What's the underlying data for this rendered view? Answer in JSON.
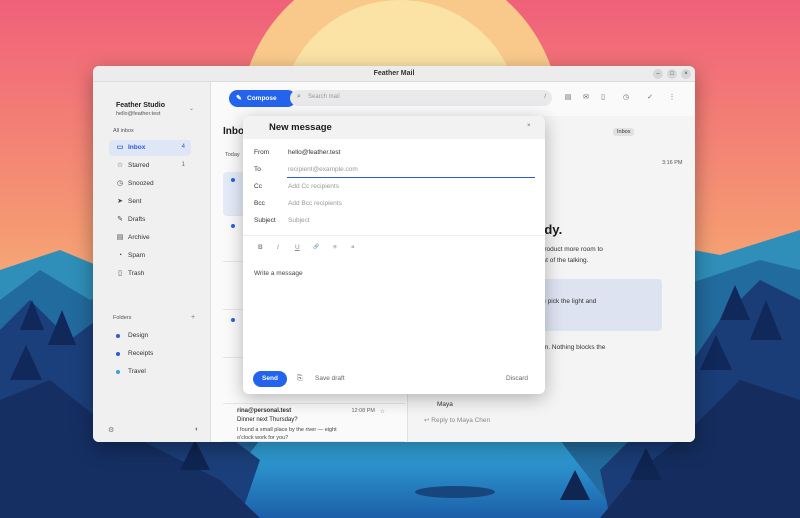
{
  "window": {
    "title": "Feather Mail",
    "controls": {
      "minimize": "–",
      "maximize": "□",
      "close": "×"
    }
  },
  "sidebar": {
    "account_name": "Feather Studio",
    "account_email": "hello@feather.test",
    "section_label": "All inbox",
    "items": [
      {
        "label": "Inbox",
        "count": "4",
        "icon": "inbox-icon",
        "glyph": "▭"
      },
      {
        "label": "Starred",
        "count": "1",
        "icon": "star-icon",
        "glyph": "☆"
      },
      {
        "label": "Snoozed",
        "count": "",
        "icon": "clock-icon",
        "glyph": "◷"
      },
      {
        "label": "Sent",
        "count": "",
        "icon": "send-icon",
        "glyph": "➤"
      },
      {
        "label": "Drafts",
        "count": "",
        "icon": "draft-icon",
        "glyph": "✎"
      },
      {
        "label": "Archive",
        "count": "",
        "icon": "archive-icon",
        "glyph": "▤"
      },
      {
        "label": "Spam",
        "count": "",
        "icon": "spam-icon",
        "glyph": "◔"
      },
      {
        "label": "Trash",
        "count": "",
        "icon": "trash-icon",
        "glyph": "▯"
      }
    ],
    "folders_label": "Folders",
    "folders": [
      {
        "label": "Design",
        "color": "#2a5bd8"
      },
      {
        "label": "Receipts",
        "color": "#2a5bd8"
      },
      {
        "label": "Travel",
        "color": "#3aa0d8"
      }
    ]
  },
  "toolbar": {
    "compose_label": "Compose",
    "search_placeholder": "Search mail",
    "search_shortcut": "/"
  },
  "list": {
    "title": "Inbox",
    "group_label": "Today",
    "messages": [
      {
        "from": "rina@personal.test",
        "time": "12:08 PM",
        "subject": "Dinner next Thursday?",
        "preview": "I found a small place by the river — eight o'clock work for you?"
      }
    ]
  },
  "reader": {
    "tag": "Inbox",
    "time": "3:16 PM",
    "heading_fragment": "s ready.",
    "body_line1": "gave the product more room to",
    "body_line2": "f to do most of the talking.",
    "callout_text": "oon as you pick the light and",
    "body_line3": "final section. Nothing blocks the",
    "signature": "Maya",
    "reply_label": "Reply to Maya Chen"
  },
  "compose": {
    "title": "New message",
    "close_glyph": "×",
    "from_label": "From",
    "from_value": "hello@feather.test",
    "to_label": "To",
    "to_placeholder": "recipient@example.com",
    "cc_label": "Cc",
    "cc_placeholder": "Add Cc recipients",
    "bcc_label": "Bcc",
    "bcc_placeholder": "Add Bcc recipients",
    "subject_label": "Subject",
    "subject_placeholder": "Subject",
    "format": {
      "bold": "B",
      "italic": "I",
      "underline": "U",
      "link": "🔗",
      "list": "≡",
      "quote": "❝"
    },
    "body_placeholder": "Write a message",
    "send_label": "Send",
    "save_draft_label": "Save draft",
    "discard_label": "Discard"
  }
}
